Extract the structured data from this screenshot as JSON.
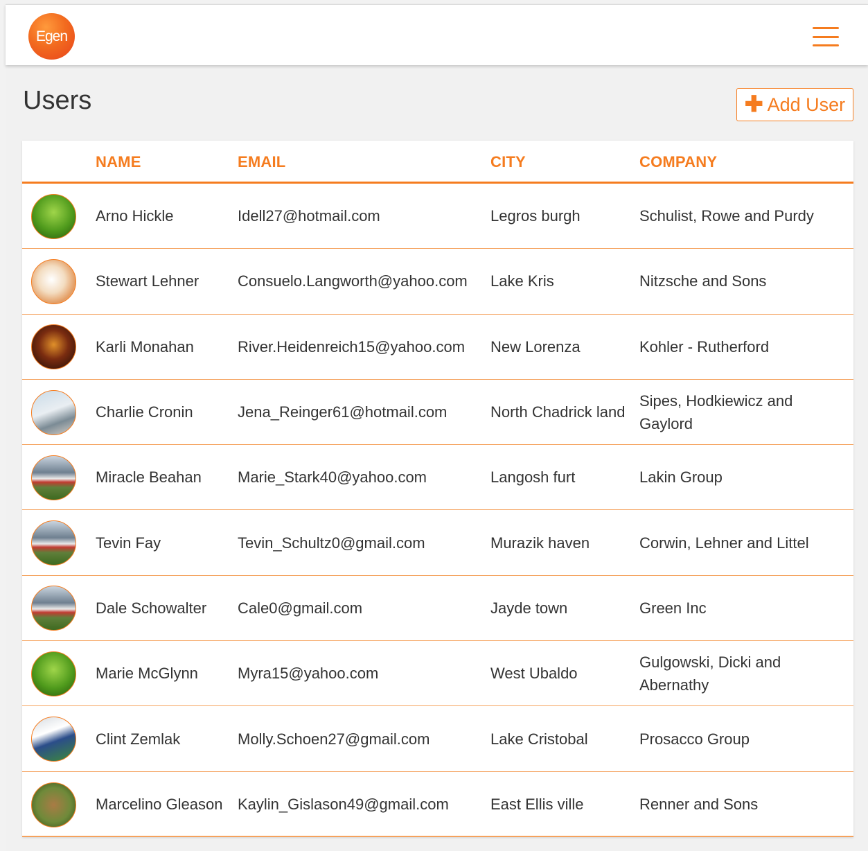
{
  "header": {
    "logo_text": "Egen",
    "menu_icon": "hamburger-menu-icon"
  },
  "page": {
    "title": "Users",
    "add_button_label": "Add User",
    "add_button_icon": "plus-icon"
  },
  "colors": {
    "accent": "#f57c1f",
    "row_divider": "#f5a25d"
  },
  "table": {
    "columns": [
      "NAME",
      "EMAIL",
      "CITY",
      "COMPANY"
    ],
    "rows": [
      {
        "avatar": "grass",
        "name": "Arno Hickle",
        "email": "Idell27@hotmail.com",
        "city": "Legros burgh",
        "company": "Schulist, Rowe and Purdy"
      },
      {
        "avatar": "food",
        "name": "Stewart Lehner",
        "email": "Consuelo.Langworth@yahoo.com",
        "city": "Lake Kris",
        "company": "Nitzsche and Sons"
      },
      {
        "avatar": "dark",
        "name": "Karli Monahan",
        "email": "River.Heidenreich15@yahoo.com",
        "city": "New Lorenza",
        "company": "Kohler - Rutherford"
      },
      {
        "avatar": "office",
        "name": "Charlie Cronin",
        "email": "Jena_Reinger61@hotmail.com",
        "city": "North Chadrick land",
        "company": "Sipes, Hodkiewicz and Gaylord"
      },
      {
        "avatar": "train",
        "name": "Miracle Beahan",
        "email": "Marie_Stark40@yahoo.com",
        "city": "Langosh furt",
        "company": "Lakin Group"
      },
      {
        "avatar": "train",
        "name": "Tevin Fay",
        "email": "Tevin_Schultz0@gmail.com",
        "city": "Murazik haven",
        "company": "Corwin, Lehner and Littel"
      },
      {
        "avatar": "train",
        "name": "Dale Schowalter",
        "email": "Cale0@gmail.com",
        "city": "Jayde town",
        "company": "Green Inc"
      },
      {
        "avatar": "grass",
        "name": "Marie McGlynn",
        "email": "Myra15@yahoo.com",
        "city": "West Ubaldo",
        "company": "Gulgowski, Dicki and Abernathy"
      },
      {
        "avatar": "baseball",
        "name": "Clint Zemlak",
        "email": "Molly.Schoen27@gmail.com",
        "city": "Lake Cristobal",
        "company": "Prosacco Group"
      },
      {
        "avatar": "deer",
        "name": "Marcelino Gleason",
        "email": "Kaylin_Gislason49@gmail.com",
        "city": "East Ellis ville",
        "company": "Renner and Sons"
      }
    ]
  }
}
